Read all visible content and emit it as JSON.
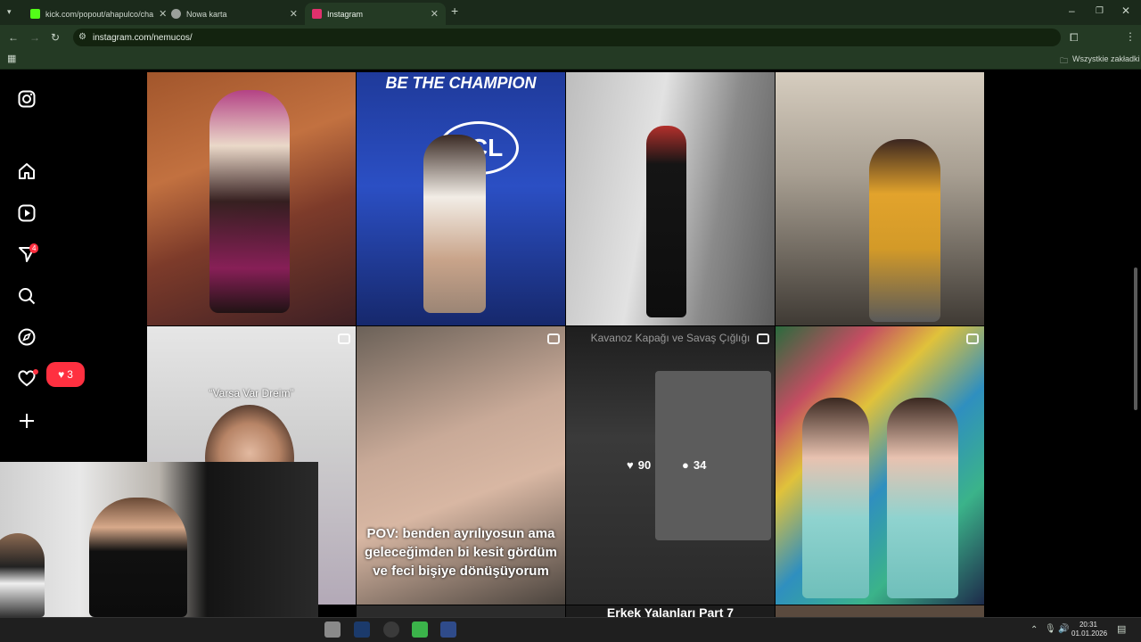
{
  "browser": {
    "tabs": [
      {
        "title": "kick.com/popout/ahapulco/cha",
        "favicon_color": "#53fc18"
      },
      {
        "title": "Nowa karta",
        "favicon_color": "#9aa09a"
      },
      {
        "title": "Instagram",
        "favicon_color": "#e1306c"
      }
    ],
    "url": "instagram.com/nemucos/",
    "bookmarks_label": "Wszystkie zakładki"
  },
  "instagram": {
    "notifications_badge": "4",
    "likes_popup_count": "3",
    "posts": [
      {
        "overlay": ""
      },
      {
        "overlay": "BE THE CHAMPION"
      },
      {
        "overlay": ""
      },
      {
        "overlay": ""
      },
      {
        "overlay": "“Varsa Var Dreim”"
      },
      {
        "overlay": "POV: benden ayrılıyosun ama geleceğimden bi kesit gördüm ve feci bişiye dönüşüyorum"
      },
      {
        "overlay": "Kavanoz Kapağı ve Savaş Çığlığı",
        "likes": "90",
        "comments": "34"
      },
      {
        "overlay": ""
      }
    ],
    "bottom_row_overlay": "Erkek Yalanları Part 7"
  },
  "taskbar": {
    "time": "20:31",
    "date": "01.01.2026"
  }
}
